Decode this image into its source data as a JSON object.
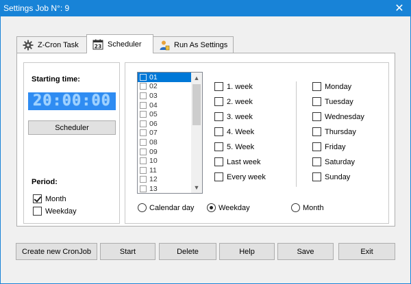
{
  "window": {
    "title": "Settings Job N°: 9",
    "close_glyph": "✕"
  },
  "tabs": [
    {
      "label": "Z-Cron Task",
      "icon": "gear-icon"
    },
    {
      "label": "Scheduler",
      "icon": "calendar-icon",
      "icon_text": "23"
    },
    {
      "label": "Run As Settings",
      "icon": "user-icon"
    }
  ],
  "active_tab": "Scheduler",
  "starting_time": {
    "label": "Starting time:",
    "value": "20:00:00",
    "scheduler_button": "Scheduler"
  },
  "period": {
    "label": "Period:",
    "options": [
      {
        "label": "Month",
        "checked": true
      },
      {
        "label": "Weekday",
        "checked": false
      }
    ]
  },
  "days_list": {
    "items": [
      "01",
      "02",
      "03",
      "04",
      "05",
      "06",
      "07",
      "08",
      "09",
      "10",
      "11",
      "12",
      "13"
    ],
    "selected": "01"
  },
  "weeks": [
    {
      "label": "1. week",
      "checked": false
    },
    {
      "label": "2. week",
      "checked": false
    },
    {
      "label": "3. week",
      "checked": false
    },
    {
      "label": "4. Week",
      "checked": false
    },
    {
      "label": "5. Week",
      "checked": false
    },
    {
      "label": "Last week",
      "checked": false
    },
    {
      "label": "Every week",
      "checked": false
    }
  ],
  "weekdays": [
    {
      "label": "Monday",
      "checked": false
    },
    {
      "label": "Tuesday",
      "checked": false
    },
    {
      "label": "Wednesday",
      "checked": false
    },
    {
      "label": "Thursday",
      "checked": false
    },
    {
      "label": "Friday",
      "checked": false
    },
    {
      "label": "Saturday",
      "checked": false
    },
    {
      "label": "Sunday",
      "checked": false
    }
  ],
  "mode": {
    "options": [
      {
        "label": "Calendar day",
        "checked": false
      },
      {
        "label": "Weekday",
        "checked": true
      },
      {
        "label": "Month",
        "checked": false
      }
    ]
  },
  "buttons": {
    "create": "Create new CronJob",
    "start": "Start",
    "delete": "Delete",
    "help": "Help",
    "save": "Save",
    "exit": "Exit"
  }
}
